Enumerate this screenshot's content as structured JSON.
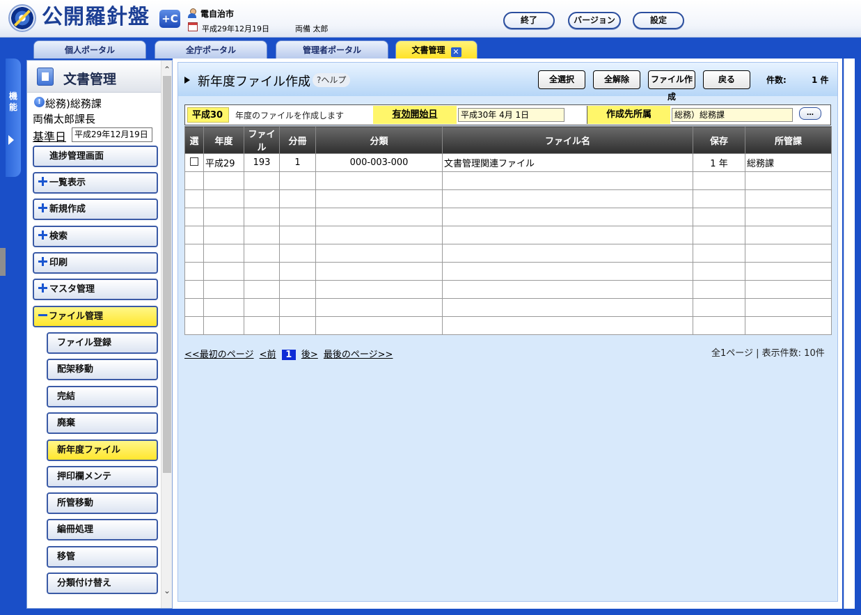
{
  "app": {
    "logo_text": "公開羅針盤",
    "logo_plus": "+C",
    "org_name": "電自治市",
    "date": "平成29年12月19日",
    "user_name": "両備 太郎",
    "buttons": {
      "exit": "終了",
      "version": "バージョン",
      "settings": "設定"
    }
  },
  "tabs": [
    {
      "label": "個人ポータル"
    },
    {
      "label": "全庁ポータル"
    },
    {
      "label": "管理者ポータル"
    },
    {
      "label": "文書管理"
    }
  ],
  "rail": {
    "label": "機能"
  },
  "sidebar": {
    "title": "文書管理",
    "dept": "総務)総務課",
    "user_title": "両備太郎課長",
    "base_date_label": "基準日",
    "base_date_value": "平成29年12月19日",
    "menu": [
      {
        "label": "進捗管理画面"
      },
      {
        "label": "一覧表示"
      },
      {
        "label": "新規作成"
      },
      {
        "label": "検索"
      },
      {
        "label": "印刷"
      },
      {
        "label": "マスタ管理"
      },
      {
        "label": "ファイル管理"
      }
    ],
    "submenu": [
      {
        "label": "ファイル登録"
      },
      {
        "label": "配架移動"
      },
      {
        "label": "完結"
      },
      {
        "label": "廃棄"
      },
      {
        "label": "新年度ファイル"
      },
      {
        "label": "押印欄メンテ"
      },
      {
        "label": "所管移動"
      },
      {
        "label": "編冊処理"
      },
      {
        "label": "移管"
      },
      {
        "label": "分類付け替え"
      }
    ]
  },
  "main": {
    "title": "新年度ファイル作成",
    "help": "?ヘルプ",
    "buttons": {
      "select_all": "全選択",
      "deselect_all": "全解除",
      "create_file": "ファイル作成",
      "back": "戻る"
    },
    "count_label": "件数:",
    "count_value": "1 件",
    "criteria": {
      "year": "平成30",
      "desc": "年度のファイルを作成します",
      "start_label": "有効開始日",
      "start_value": "平成30年 4月 1日",
      "dept_label": "作成先所属",
      "dept_value": "総務）総務課",
      "dept_button": "…"
    },
    "table": {
      "headers": [
        "選",
        "年度",
        "ファイル",
        "分冊",
        "分類",
        "ファイル名",
        "保存",
        "所管課"
      ],
      "rows": [
        [
          "",
          "平成29",
          "193",
          "1",
          "000-003-000",
          "文書管理関連ファイル",
          "1 年",
          "総務課"
        ],
        [
          "",
          "",
          "",
          "",
          "",
          "",
          "",
          ""
        ],
        [
          "",
          "",
          "",
          "",
          "",
          "",
          "",
          ""
        ],
        [
          "",
          "",
          "",
          "",
          "",
          "",
          "",
          ""
        ],
        [
          "",
          "",
          "",
          "",
          "",
          "",
          "",
          ""
        ],
        [
          "",
          "",
          "",
          "",
          "",
          "",
          "",
          ""
        ],
        [
          "",
          "",
          "",
          "",
          "",
          "",
          "",
          ""
        ],
        [
          "",
          "",
          "",
          "",
          "",
          "",
          "",
          ""
        ],
        [
          "",
          "",
          "",
          "",
          "",
          "",
          "",
          ""
        ],
        [
          "",
          "",
          "",
          "",
          "",
          "",
          "",
          ""
        ]
      ]
    },
    "pager": {
      "first": "<<最初のページ",
      "prev": "<前",
      "current": "1",
      "next": "後>",
      "last": "最後のページ>>",
      "summary": "全1ページ | 表示件数: 10件"
    }
  }
}
